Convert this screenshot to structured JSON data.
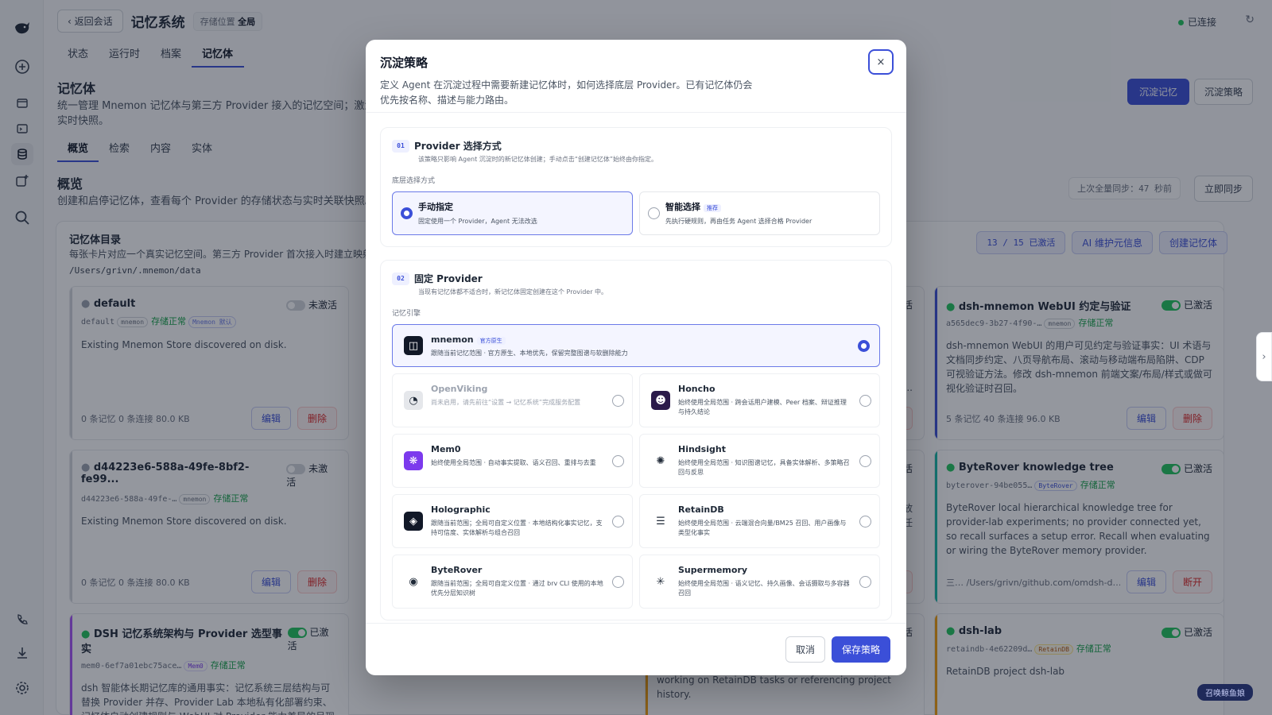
{
  "rail": {
    "icons": [
      "logo-icon",
      "plus-circle-icon",
      "panel-icon",
      "terminal-icon",
      "database-icon",
      "add-box-icon",
      "search-icon",
      "phone-icon",
      "download-icon",
      "settings-icon"
    ]
  },
  "header": {
    "back": "返回会话",
    "title": "记忆系统",
    "storage_label": "存储位置",
    "storage_value": "全局",
    "connected": "已连接"
  },
  "top_tabs": [
    "状态",
    "运行时",
    "档案",
    "记忆体"
  ],
  "section": {
    "title": "记忆体",
    "desc": "统一管理 Mnemon 记忆体与第三方 Provider 接入的记忆空间；激活",
    "desc2": "实时快照。",
    "btn_settle": "沉淀记忆",
    "btn_policy": "沉淀策略"
  },
  "sub_tabs": [
    "概览",
    "检索",
    "内容",
    "实体"
  ],
  "overview": {
    "title": "概览",
    "desc": "创建和启停记忆体，查看每个 Provider 的存储状态与实时关联快照。",
    "last_sync": "上次全量同步：47 秒前",
    "sync_now": "立即同步"
  },
  "catalog": {
    "title": "记忆体目录",
    "desc": "每张卡片对应一个真实记忆空间。第三方 Provider 首次接入时建立映射",
    "path": "/Users/grivn/.mnemon/data",
    "active_count": "13 / 15 已激活",
    "ai_btn": "AI 维护元信息",
    "create_btn": "创建记忆体"
  },
  "cards_left": [
    {
      "name": "default",
      "id": "default",
      "tags": [
        "mnemon"
      ],
      "status": "存储正常",
      "extra_tag": "Mnemon 默认",
      "state": "未激活",
      "body": "Existing Mnemon Store discovered on disk.",
      "foot": "0 条记忆   0 条连接   80.0 KB",
      "edit": "编辑",
      "del": "删除"
    },
    {
      "name": "d44223e6-588a-49fe-8bf2-fe99...",
      "id": "d44223e6-588a-49fe-…",
      "tags": [
        "mnemon"
      ],
      "status": "存储正常",
      "state": "未激活",
      "body": "Existing Mnemon Store discovered on disk.",
      "foot": "0 条记忆   0 条连接   80.0 KB",
      "edit": "编辑",
      "del": "删除"
    },
    {
      "name": "DSH 记忆系统架构与 Provider 选型事实",
      "id": "mem0-6ef7a01ebc75ace…",
      "tags": [
        "Mem0"
      ],
      "status": "存储正常",
      "state": "已激活",
      "body": "dsh 智能体长期记忆库的通用事实：记忆系统三层结构与可替换 Provider 并存、Provider Lab 本地私有化部署约束、记忆体自动创建规则与 WebUI 对 Provider 能力差异的呈现方式。讨论 DSH 记忆架构或 Provider 集成设计时召回。"
    }
  ],
  "cards_right": [
    {
      "name": "dsh-mnemon WebUI 约定与验证",
      "id": "a565dec9-3b27-4f90-…",
      "tags": [
        "mnemon"
      ],
      "status": "存储正常",
      "state": "已激活",
      "body": "dsh-mnemon WebUI 的用户可见约定与验证事实：UI 术语与文档同步约定、八页导航布局、滚动与移动端布局陷阱、CDP 可视验证方法。修改 dsh-mnemon 前端文案/布局/样式或做可视化验证时召回。",
      "foot": "5 条记忆   40 条连接   96.0 KB",
      "edit": "编辑",
      "del": "删除"
    },
    {
      "name": "ByteRover knowledge tree",
      "id": "byterover-94be055…",
      "tags": [
        "ByteRover"
      ],
      "status": "存储正常",
      "state": "已激活",
      "body": "ByteRover local hierarchical knowledge tree for provider-lab experiments; no provider connected yet, so recall surfaces a setup error. Recall when evaluating or wiring the ByteRover memory provider.",
      "foot": "三…   /Users/grivn/github.com/omdsh-d…",
      "edit": "编辑",
      "del": "断开"
    },
    {
      "name": "dsh-lab",
      "id": "retaindb-4e62209d…",
      "tags": [
        "RetainDB"
      ],
      "status": "存储正常",
      "state": "已激活",
      "body": "RetainDB project dsh-lab"
    }
  ],
  "peek": {
    "t1": "已激活",
    "t2": "已激活",
    "t3": "已激活",
    "b1": "删除",
    "b2": "断开",
    "b3": "开",
    "frag1": "事",
    "frag2": "与缓",
    "frag3": "链位",
    "frag4": "emo...",
    "frag5": "：存放",
    "frag6": "与信任",
    "frag7": "files, documents, and memory records. Recall when working on RetainDB tasks or referencing project history.",
    "frag8": "t files,",
    "frag9": "的规则与 Prompt 边界、WebUI 对各 Provider 的差异化展示，以及 Provider Lab 本地私有部署方式；讨论记忆架构、Provider 选择与本地部署时召回。"
  },
  "modal": {
    "title": "沉淀策略",
    "desc": "定义 Agent 在沉淀过程中需要新建记忆体时，如何选择底层 Provider。已有记忆体仍会优先按名称、描述与能力路由。",
    "close": "×",
    "sec1": {
      "num": "01",
      "title": "Provider 选择方式",
      "desc": "该策略只影响 Agent 沉淀时的新记忆体创建；手动点击“创建记忆体”始终由你指定。",
      "label": "底层选择方式",
      "options": [
        {
          "title": "手动指定",
          "desc": "固定使用一个 Provider，Agent 无法改选",
          "selected": true
        },
        {
          "title": "智能选择",
          "badge": "推荐",
          "desc": "先执行硬规则，再由任务 Agent 选择合格 Provider",
          "selected": false
        }
      ]
    },
    "sec2": {
      "num": "02",
      "title": "固定 Provider",
      "desc": "当现有记忆体都不适合时，新记忆体固定创建在这个 Provider 中。",
      "label": "记忆引擎",
      "main": {
        "title": "mnemon",
        "badge": "官方原生",
        "desc": "跟随当前记忆范围 · 官方原生、本地优先，保留完整图谱与软删除能力"
      },
      "providers": [
        {
          "title": "OpenViking",
          "desc": "尚未启用，请先前往“设置 → 记忆系统”完成服务配置",
          "icon": "openviking-icon",
          "color": "#e5e7eb",
          "disabled": true
        },
        {
          "title": "Honcho",
          "desc": "始终使用全局范围 · 跨会话用户建模、Peer 档案、辩证推理与持久结论",
          "icon": "honcho-icon",
          "color": "#2b1a4a"
        },
        {
          "title": "Mem0",
          "desc": "始终使用全局范围 · 自动事实提取、语义召回、重排与去重",
          "icon": "mem0-icon",
          "color": "#7c3aed"
        },
        {
          "title": "Hindsight",
          "desc": "始终使用全局范围 · 知识图谱记忆，具备实体解析、多策略召回与反思",
          "icon": "hindsight-icon",
          "color": "#ffffff"
        },
        {
          "title": "Holographic",
          "desc": "跟随当前范围；全局可自定义位置 · 本地结构化事实记忆，支持可信度、实体解析与组合召回",
          "icon": "holographic-icon",
          "color": "#111827"
        },
        {
          "title": "RetainDB",
          "desc": "始终使用全局范围 · 云端混合向量/BM25 召回、用户画像与类型化事实",
          "icon": "retaindb-icon",
          "color": "#ffffff"
        },
        {
          "title": "ByteRover",
          "desc": "跟随当前范围；全局可自定义位置 · 通过 brv CLI 使用的本地优先分层知识树",
          "icon": "byterover-icon",
          "color": "#ffffff"
        },
        {
          "title": "Supermemory",
          "desc": "始终使用全局范围 · 语义记忆、持久画像、会话摄取与多容器召回",
          "icon": "supermemory-icon",
          "color": "#ffffff"
        }
      ]
    },
    "cancel": "取消",
    "save": "保存策略"
  },
  "floating_badge": "召唤鲸鱼娘"
}
